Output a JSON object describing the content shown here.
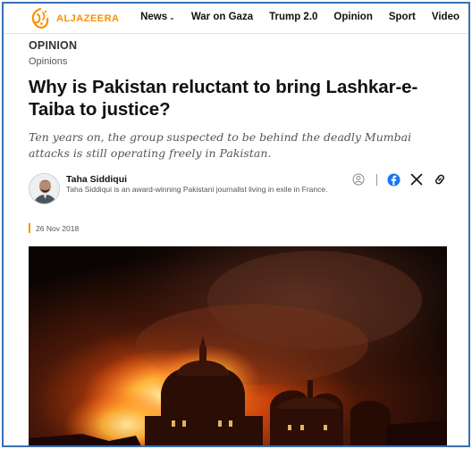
{
  "brand": {
    "name": "ALJAZEERA",
    "accent_color": "#fa9000"
  },
  "nav": {
    "items": [
      {
        "label": "News",
        "has_dropdown": true
      },
      {
        "label": "War on Gaza"
      },
      {
        "label": "Trump 2.0"
      },
      {
        "label": "Opinion"
      },
      {
        "label": "Sport"
      },
      {
        "label": "Video"
      }
    ]
  },
  "article": {
    "section": "OPINION",
    "category": "Opinions",
    "headline": "Why is Pakistan reluctant to bring Lashkar-e-Taiba to justice?",
    "standfirst": "Ten years on, the group suspected to be behind the deadly Mumbai attacks is still operating freely in Pakistan.",
    "author": {
      "name": "Taha Siddiqui",
      "bio": "Taha Siddiqui is an award-winning Pakistani journalist living in exile in France."
    },
    "date": "26 Nov 2018"
  },
  "share": {
    "icons": [
      "listen-icon",
      "facebook-icon",
      "x-icon",
      "link-icon"
    ]
  }
}
